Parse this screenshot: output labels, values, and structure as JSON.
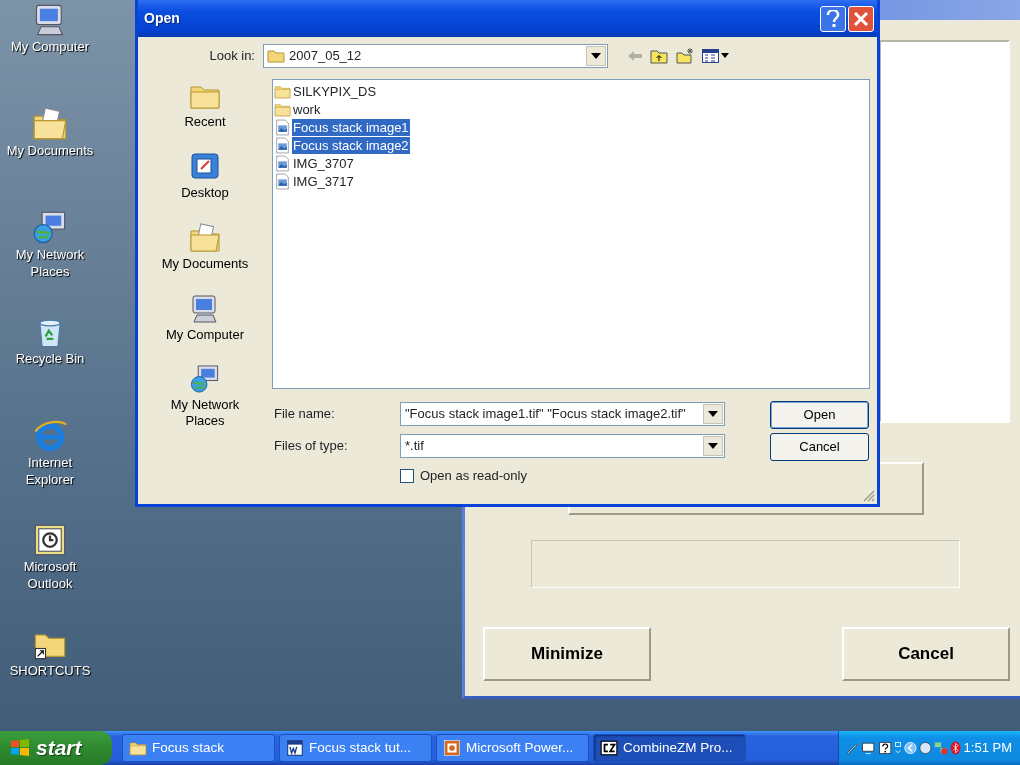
{
  "desktop_icons": [
    {
      "label": "My Computer",
      "kind": "computer"
    },
    {
      "label": "My Documents",
      "kind": "documents"
    },
    {
      "label": "My Network Places",
      "kind": "network"
    },
    {
      "label": "Recycle Bin",
      "kind": "recycle"
    },
    {
      "label": "Internet Explorer",
      "kind": "browser"
    },
    {
      "label": "Microsoft Outlook",
      "kind": "mail"
    },
    {
      "label": "SHORTCUTS",
      "kind": "shortcut"
    }
  ],
  "background_window": {
    "buttons": [
      "Minimize",
      "Cancel"
    ]
  },
  "dialog": {
    "title": "Open",
    "look_in_label": "Look in:",
    "look_in": "2007_05_12",
    "places": [
      {
        "label": "Recent",
        "kind": "recent"
      },
      {
        "label": "Desktop",
        "kind": "desktop"
      },
      {
        "label": "My Documents",
        "kind": "documents"
      },
      {
        "label": "My Computer",
        "kind": "computer"
      },
      {
        "label": "My Network Places",
        "kind": "network"
      }
    ],
    "files": [
      {
        "name": "SILKYPIX_DS",
        "kind": "folder",
        "selected": false
      },
      {
        "name": "work",
        "kind": "folder",
        "selected": false
      },
      {
        "name": "Focus stack image1",
        "kind": "image",
        "selected": true
      },
      {
        "name": "Focus stack image2",
        "kind": "image",
        "selected": true
      },
      {
        "name": "IMG_3707",
        "kind": "image",
        "selected": false
      },
      {
        "name": "IMG_3717",
        "kind": "image",
        "selected": false
      }
    ],
    "file_name_label": "File name:",
    "file_name": "\"Focus stack image1.tif\" \"Focus stack image2.tif\"",
    "file_type_label": "Files of type:",
    "file_type": "*.tif",
    "read_only": {
      "label": "Open as read-only",
      "checked": false
    },
    "buttons": [
      "Open",
      "Cancel"
    ]
  },
  "taskbar": {
    "start": "start",
    "tasks": [
      {
        "label": "Focus stack",
        "kind": "folder",
        "selected": false
      },
      {
        "label": "Focus stack tut...",
        "kind": "word",
        "selected": false
      },
      {
        "label": "Microsoft Power...",
        "kind": "slides",
        "selected": false
      },
      {
        "label": "CombineZM Pro...",
        "kind": "app",
        "selected": true
      }
    ],
    "clock": "1:51 PM"
  }
}
